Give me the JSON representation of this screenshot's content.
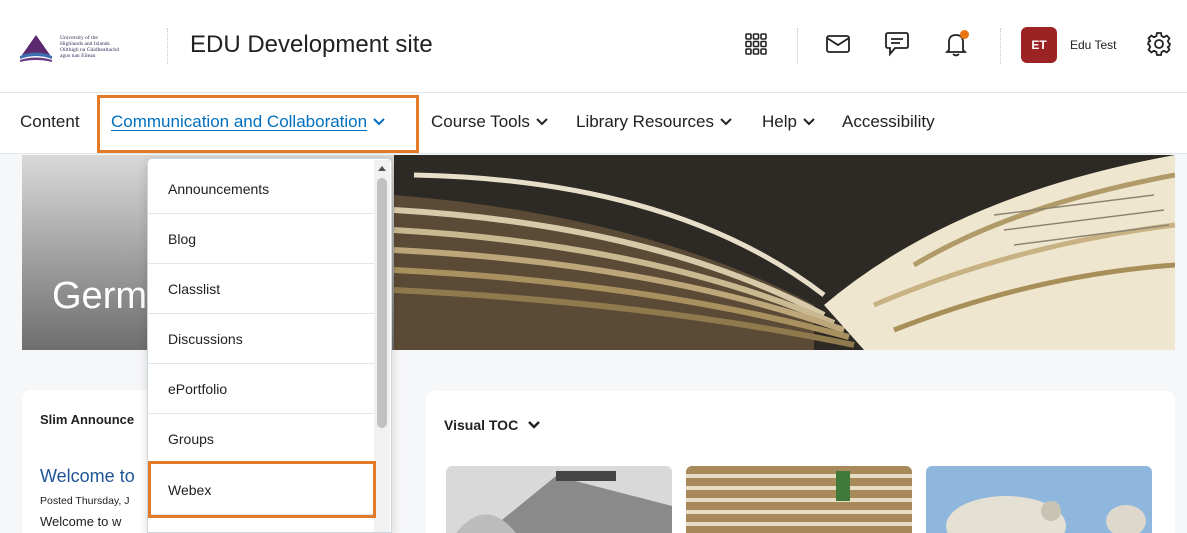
{
  "header": {
    "logo_lines": [
      "University of the",
      "Highlands and Islands",
      "Oilthigh na Gàidhealtachd",
      "agus nan Eilean"
    ],
    "site_title": "EDU Development site",
    "icons": [
      "apps-grid-icon",
      "mail-icon",
      "chat-icon",
      "bell-icon",
      "gear-icon"
    ],
    "avatar_initials": "ET",
    "user_name": "Edu Test",
    "colors": {
      "avatar_bg": "#9b2323",
      "notification_dot": "#e87511"
    }
  },
  "nav": {
    "items": [
      {
        "label": "Content",
        "has_dropdown": false
      },
      {
        "label": "Communication and Collaboration",
        "has_dropdown": true,
        "active": true
      },
      {
        "label": "Course Tools",
        "has_dropdown": true
      },
      {
        "label": "Library Resources",
        "has_dropdown": true
      },
      {
        "label": "Help",
        "has_dropdown": true
      },
      {
        "label": "Accessibility",
        "has_dropdown": false
      }
    ],
    "active_color": "#006fbf",
    "highlight_color": "#e27a28"
  },
  "banner": {
    "title": "Germ"
  },
  "dropdown": {
    "items": [
      "Announcements",
      "Blog",
      "Classlist",
      "Discussions",
      "ePortfolio",
      "Groups",
      "Webex"
    ],
    "highlighted_item": "Webex"
  },
  "announcements_widget": {
    "title": "Slim Announce",
    "headline": "Welcome to",
    "posted": "Posted Thursday, J",
    "body_start": "Welcome to w"
  },
  "visual_toc": {
    "title": "Visual TOC"
  }
}
